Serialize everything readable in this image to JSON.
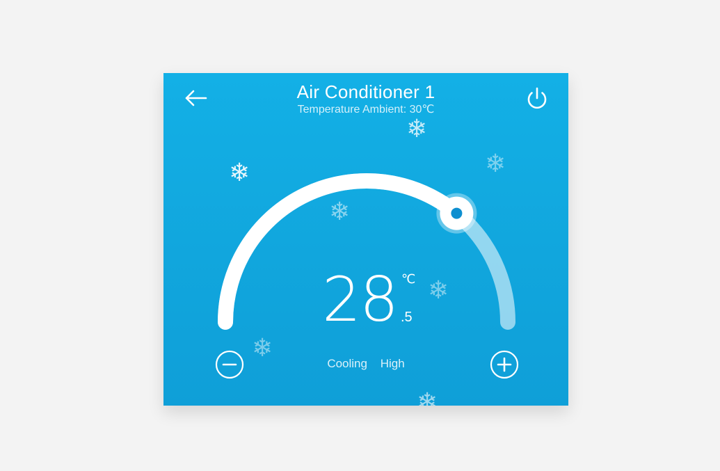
{
  "header": {
    "title": "Air Conditioner 1",
    "subtitle": "Temperature Ambient: 30℃",
    "back_icon": "arrow-left-icon",
    "power_icon": "power-icon"
  },
  "temperature": {
    "integer": "28",
    "decimal": ".5",
    "unit": "℃",
    "slider_level": 0.72
  },
  "status": {
    "mode": "Cooling",
    "fan": "High"
  },
  "controls": {
    "decrease_icon": "minus-circle-icon",
    "increase_icon": "plus-circle-icon"
  },
  "decoration": {
    "snowflake_icon": "snowflake-icon",
    "snowflake_glyph": "❄"
  },
  "colors": {
    "background": "#f3f3f3",
    "card": "#11a8df",
    "accent": "#0e8fd0",
    "foreground": "#ffffff"
  }
}
